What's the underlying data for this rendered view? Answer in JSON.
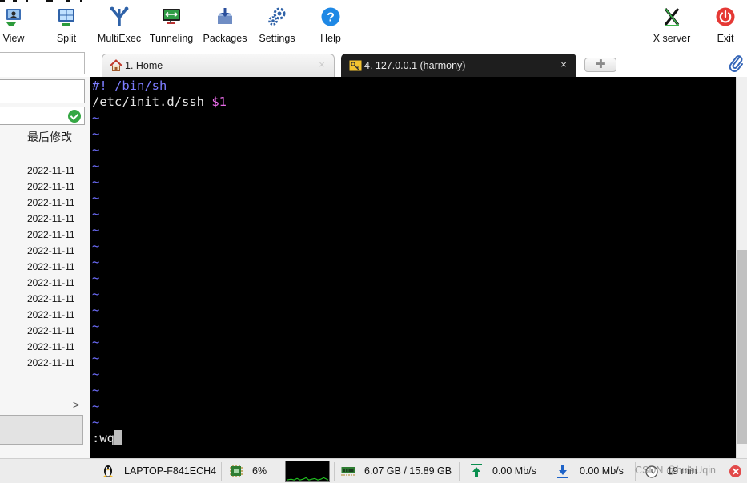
{
  "toolbar": {
    "buttons": [
      {
        "label": "View"
      },
      {
        "label": "Split"
      },
      {
        "label": "MultiExec"
      },
      {
        "label": "Tunneling"
      },
      {
        "label": "Packages"
      },
      {
        "label": "Settings"
      },
      {
        "label": "Help"
      },
      {
        "label": "X server"
      },
      {
        "label": "Exit"
      }
    ]
  },
  "tabs": [
    {
      "label": "1. Home",
      "close": "×"
    },
    {
      "label": "4. 127.0.0.1 (harmony)",
      "close": "×"
    }
  ],
  "new_tab": {
    "label": "✚"
  },
  "sidebar": {
    "column_header": "最后修改",
    "dates": [
      "2022-11-11",
      "2022-11-11",
      "2022-11-11",
      "2022-11-11",
      "2022-11-11",
      "2022-11-11",
      "2022-11-11",
      "2022-11-11",
      "2022-11-11",
      "2022-11-11",
      "2022-11-11",
      "2022-11-11",
      "2022-11-11"
    ],
    "scroll_arrow": ">"
  },
  "terminal": {
    "shebang": "#! /bin/sh",
    "command": "/etc/init.d/ssh ",
    "argument": "$1",
    "tilde": "~",
    "tilde_count": 20,
    "command_line": ":wq"
  },
  "statusbar": {
    "hostname": "LAPTOP-F841ECH4",
    "cpu": "6%",
    "memory": "6.07 GB / 15.89 GB",
    "upload": "0.00 Mb/s",
    "download": "0.00 Mb/s",
    "uptime": "19 min",
    "watermark": "CSDN @hulaUqin"
  },
  "colors": {
    "terminal_bg": "#000000",
    "shebang": "#7d7dff",
    "variable": "#e86be8",
    "tilde": "#6f6fff",
    "active_tab": "#1e1e1e",
    "help_blue": "#1e88e5",
    "exit_red": "#e53935"
  }
}
